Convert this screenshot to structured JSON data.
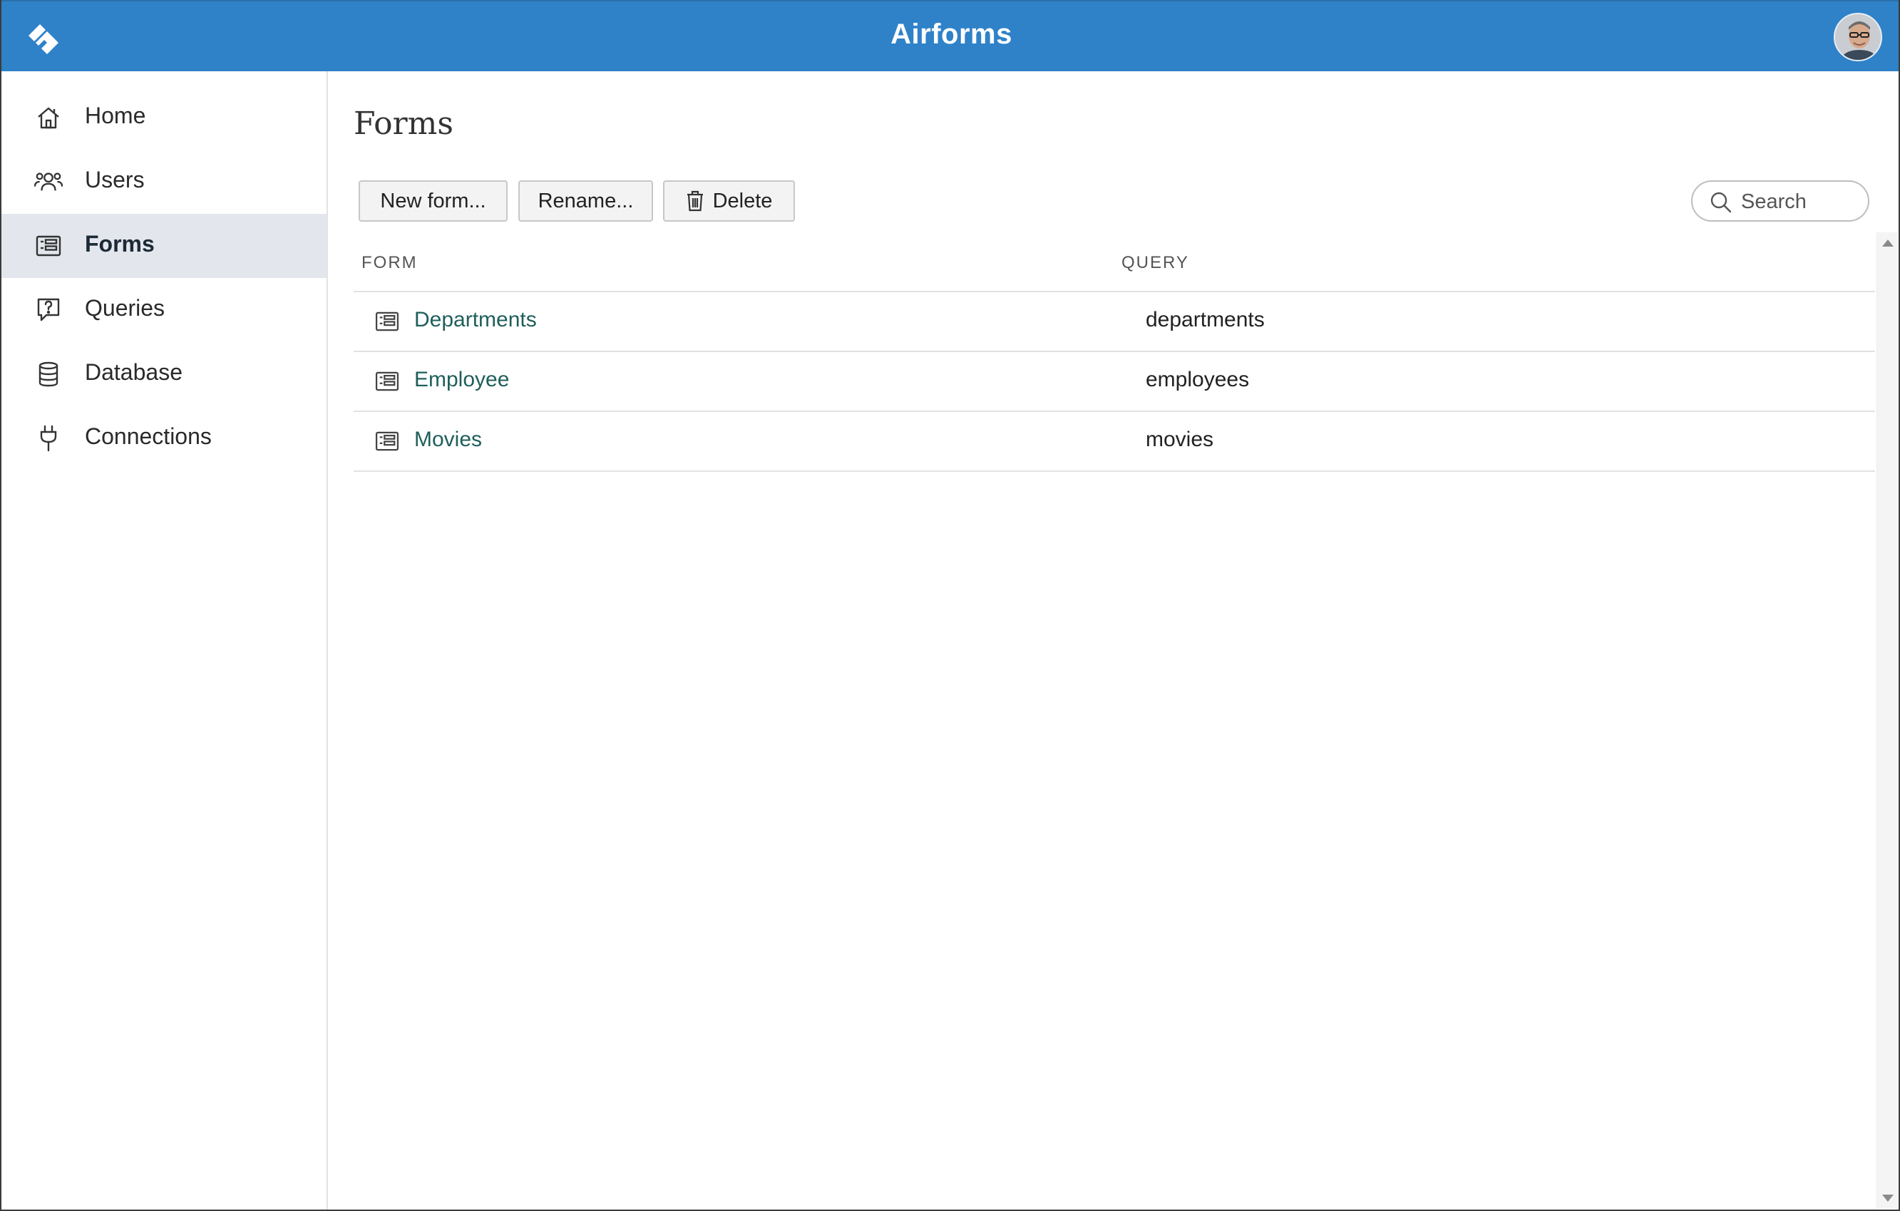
{
  "header": {
    "title": "Airforms",
    "brand_color": "#2f82c8"
  },
  "sidebar": {
    "items": [
      {
        "label": "Home",
        "icon": "home-icon",
        "active": false
      },
      {
        "label": "Users",
        "icon": "users-icon",
        "active": false
      },
      {
        "label": "Forms",
        "icon": "form-icon",
        "active": true
      },
      {
        "label": "Queries",
        "icon": "query-icon",
        "active": false
      },
      {
        "label": "Database",
        "icon": "database-icon",
        "active": false
      },
      {
        "label": "Connections",
        "icon": "plug-icon",
        "active": false
      }
    ]
  },
  "main": {
    "title": "Forms",
    "toolbar": {
      "new_label": "New form...",
      "rename_label": "Rename...",
      "delete_label": "Delete"
    },
    "search": {
      "placeholder": "Search",
      "value": ""
    },
    "table": {
      "columns": [
        "FORM",
        "QUERY"
      ],
      "rows": [
        {
          "form": "Departments",
          "query": "departments"
        },
        {
          "form": "Employee",
          "query": "employees"
        },
        {
          "form": "Movies",
          "query": "movies"
        }
      ]
    }
  },
  "colors": {
    "link": "#1f5f5b",
    "active_nav_bg": "#e3e7ed"
  }
}
